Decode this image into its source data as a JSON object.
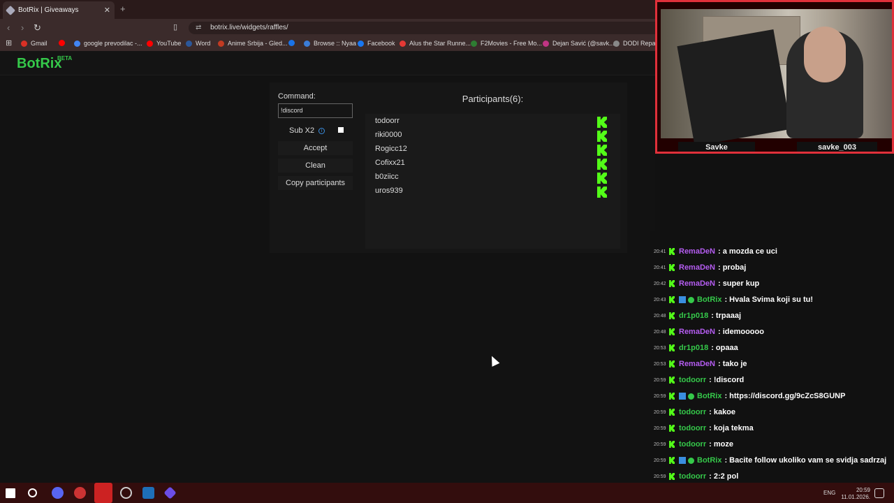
{
  "browser": {
    "tab_title": "BotRix | Giveaways",
    "tab_close": "✕",
    "new_tab": "+",
    "url": "botrix.live/widgets/raffles/",
    "site_icon": "⇄",
    "bookmarks": [
      {
        "label": "Gmail",
        "color": "#d93025"
      },
      {
        "label": "",
        "color": "#ff0000"
      },
      {
        "label": "google prevodilac -...",
        "color": "#4285f4"
      },
      {
        "label": "YouTube",
        "color": "#ff0000"
      },
      {
        "label": "Word",
        "color": "#2b579a"
      },
      {
        "label": "Anime Srbija - Gled...",
        "color": "#c23b22"
      },
      {
        "label": "",
        "color": "#1a73e8"
      },
      {
        "label": "Browse :: Nyaa",
        "color": "#3b7dd8"
      },
      {
        "label": "Facebook",
        "color": "#1877f2"
      },
      {
        "label": "Alus the Star Runne...",
        "color": "#e53935"
      },
      {
        "label": "F2Movies - Free Mo...",
        "color": "#2e7d32"
      },
      {
        "label": "Dejan Savić (@savk...",
        "color": "#c13584"
      },
      {
        "label": "DODI Repacks",
        "color": "#888888"
      }
    ]
  },
  "app": {
    "logo": "BotRix",
    "logo_badge": "BETA",
    "command_label": "Command:",
    "command_value": "!discord",
    "sub_label": "Sub X2",
    "info_icon": "i",
    "accept": "Accept",
    "clean": "Clean",
    "copy": "Copy participants",
    "participants_title": "Participants(6):",
    "participants": [
      "todoorr",
      "riki0000",
      "Rogicc12",
      "Cofixx21",
      "b0ziicc",
      "uros939"
    ]
  },
  "webcam": {
    "name_left": "Savke",
    "name_right": "savke_003"
  },
  "chat": {
    "messages": [
      {
        "time": "20:41",
        "user": "RemaDeN",
        "color": "#b45cf0",
        "text": ": a mozda ce uci",
        "bot": false
      },
      {
        "time": "20:41",
        "user": "RemaDeN",
        "color": "#b45cf0",
        "text": ": probaj",
        "bot": false
      },
      {
        "time": "20:42",
        "user": "RemaDeN",
        "color": "#b45cf0",
        "text": ": super kup",
        "bot": false
      },
      {
        "time": "20:43",
        "user": "BotRix",
        "color": "#35c94a",
        "text": ": Hvala Svima koji su tu!",
        "bot": true
      },
      {
        "time": "20:48",
        "user": "dr1p018",
        "color": "#35c94a",
        "text": ": trpaaaj",
        "bot": false
      },
      {
        "time": "20:48",
        "user": "RemaDeN",
        "color": "#b45cf0",
        "text": ": idemooooo",
        "bot": false
      },
      {
        "time": "20:53",
        "user": "dr1p018",
        "color": "#35c94a",
        "text": ": opaaa",
        "bot": false
      },
      {
        "time": "20:53",
        "user": "RemaDeN",
        "color": "#b45cf0",
        "text": ": tako je",
        "bot": false
      },
      {
        "time": "20:59",
        "user": "todoorr",
        "color": "#35c94a",
        "text": ": !discord",
        "bot": false
      },
      {
        "time": "20:59",
        "user": "BotRix",
        "color": "#35c94a",
        "text": ": https://discord.gg/9cZcS8GUNP",
        "bot": true
      },
      {
        "time": "20:59",
        "user": "todoorr",
        "color": "#35c94a",
        "text": ": kakoe",
        "bot": false
      },
      {
        "time": "20:59",
        "user": "todoorr",
        "color": "#35c94a",
        "text": ": koja tekma",
        "bot": false
      },
      {
        "time": "20:59",
        "user": "todoorr",
        "color": "#35c94a",
        "text": ": moze",
        "bot": false
      },
      {
        "time": "20:59",
        "user": "BotRix",
        "color": "#35c94a",
        "text": ": Bacite follow ukoliko vam se svidja sadrzaj",
        "bot": true
      },
      {
        "time": "20:59",
        "user": "todoorr",
        "color": "#35c94a",
        "text": ": 2:2 pol",
        "bot": false
      }
    ]
  },
  "taskbar": {
    "lang": "ENG",
    "time": "20:59",
    "date": "11.01.2026."
  }
}
